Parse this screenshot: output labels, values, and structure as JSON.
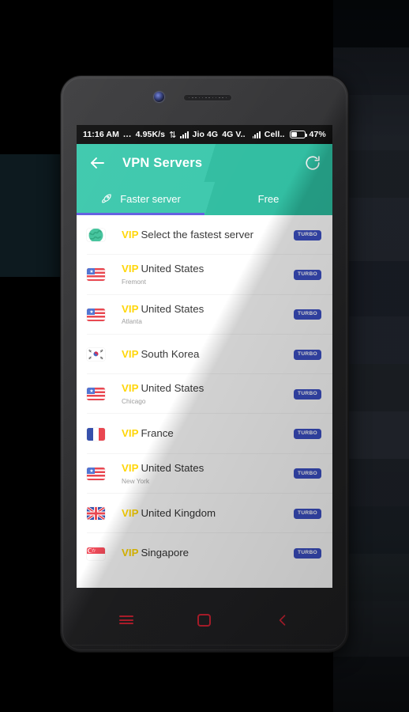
{
  "status_bar": {
    "time": "11:16 AM",
    "dots": "...",
    "net_speed": "4.95K/s",
    "updown_icon": "data-transfer-icon",
    "signal1_icon": "signal-bars-icon",
    "carrier1": "Jio 4G",
    "network_type": "4G V..",
    "signal2_icon": "signal-bars-icon",
    "carrier2": "Cell..",
    "battery_icon": "battery-icon",
    "battery_percent": "47%"
  },
  "app_bar": {
    "back_icon": "back-arrow-icon",
    "title": "VPN Servers",
    "refresh_icon": "refresh-icon"
  },
  "tabs": {
    "indicator_color": "#5f5be0",
    "items": [
      {
        "label": "Faster server",
        "icon": "rocket-icon",
        "active": true
      },
      {
        "label": "Free",
        "icon": "",
        "active": false
      }
    ]
  },
  "servers": {
    "vip_label": "VIP",
    "badge_label": "TURBO",
    "items": [
      {
        "flag": "globe-icon",
        "name": "Select the fastest server",
        "city": "",
        "vip": true,
        "badge": "TURBO"
      },
      {
        "flag": "flag-united-states",
        "name": "United States",
        "city": "Fremont",
        "vip": true,
        "badge": "TURBO"
      },
      {
        "flag": "flag-united-states",
        "name": "United States",
        "city": "Atlanta",
        "vip": true,
        "badge": "TURBO"
      },
      {
        "flag": "flag-south-korea",
        "name": "South Korea",
        "city": "",
        "vip": true,
        "badge": "TURBO"
      },
      {
        "flag": "flag-united-states",
        "name": "United States",
        "city": "Chicago",
        "vip": true,
        "badge": "TURBO"
      },
      {
        "flag": "flag-france",
        "name": "France",
        "city": "",
        "vip": true,
        "badge": "TURBO"
      },
      {
        "flag": "flag-united-states",
        "name": "United States",
        "city": "New York",
        "vip": true,
        "badge": "TURBO"
      },
      {
        "flag": "flag-united-kingdom",
        "name": "United Kingdom",
        "city": "",
        "vip": true,
        "badge": "TURBO"
      },
      {
        "flag": "flag-singapore",
        "name": "Singapore",
        "city": "",
        "vip": true,
        "badge": "TURBO"
      }
    ]
  },
  "nav_bar": {
    "menu_icon": "menu-icon",
    "home_icon": "home-icon",
    "back_icon": "back-chevron-icon",
    "icon_color": "#cf2233"
  },
  "theme": {
    "accent": "#2ec4a6",
    "vip_color": "#ffd500",
    "badge_color": "#3b4fc4"
  }
}
